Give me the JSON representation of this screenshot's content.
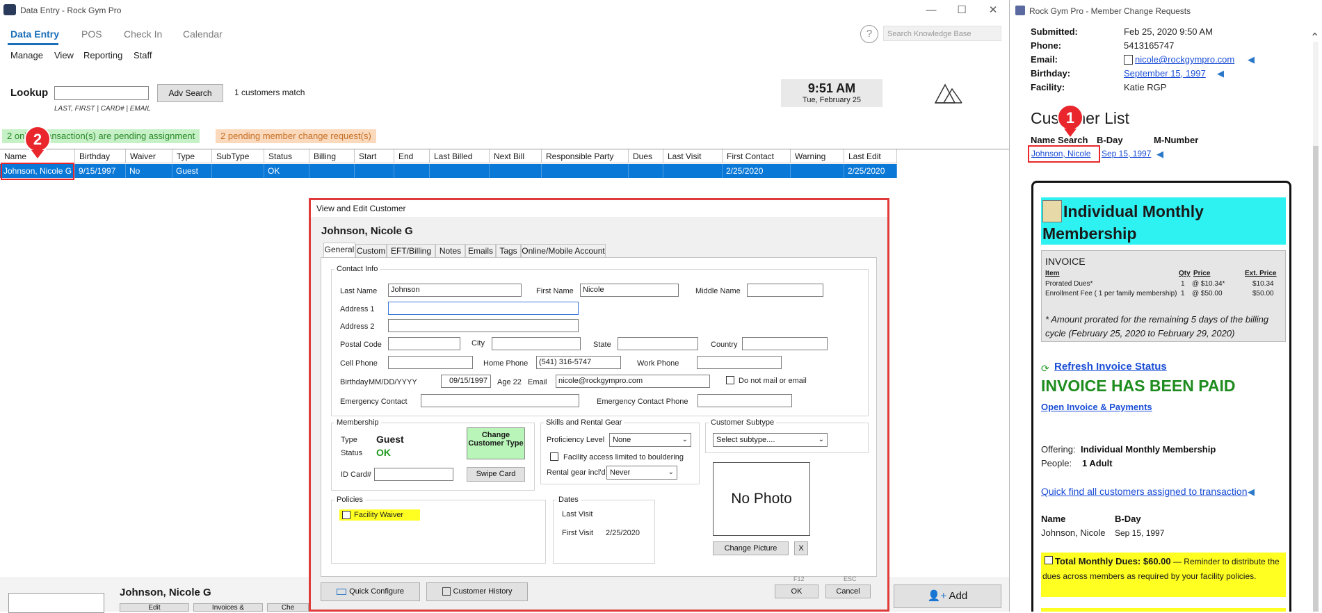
{
  "main": {
    "title": "Data Entry - Rock Gym Pro",
    "nav_tabs": [
      "Data Entry",
      "POS",
      "Check In",
      "Calendar"
    ],
    "menu": [
      "Manage",
      "View",
      "Reporting",
      "Staff"
    ],
    "kb_search_placeholder": "Search Knowledge Base",
    "help": "?",
    "lookup": {
      "label": "Lookup",
      "hint": "LAST, FIRST | CARD# | EMAIL",
      "adv_search": "Adv Search",
      "match_count": "1 customers match"
    },
    "clock": {
      "time": "9:51 AM",
      "date": "Tue, February 25"
    },
    "pending_transactions": "2 online transaction(s) are pending assignment",
    "pending_requests": "2 pending member change request(s)",
    "grid": {
      "columns": [
        "Name",
        "Birthday",
        "Waiver",
        "Type",
        "SubType",
        "Status",
        "Billing",
        "Start",
        "End",
        "Last Billed",
        "Next Bill",
        "Responsible Party",
        "Dues",
        "Last Visit",
        "First Contact",
        "Warning",
        "Last Edit"
      ],
      "row": [
        "Johnson, Nicole G",
        "9/15/1997",
        "No",
        "Guest",
        "",
        "OK",
        "",
        "",
        "",
        "",
        "",
        "",
        "",
        "",
        "2/25/2020",
        "",
        "2/25/2020"
      ]
    },
    "bottom": {
      "customer_name": "Johnson, Nicole G",
      "add_button": "Add",
      "btn1": "Edit",
      "btn2": "Invoices &",
      "btn3": "Che"
    }
  },
  "markers": {
    "one": "1",
    "two": "2"
  },
  "dialog": {
    "title": "View and Edit Customer",
    "customer_name": "Johnson, Nicole G",
    "tabs": [
      "General",
      "Custom",
      "EFT/Billing",
      "Notes",
      "Emails",
      "Tags",
      "Online/Mobile Account"
    ],
    "contact": {
      "group": "Contact Info",
      "last_name_label": "Last Name",
      "last_name": "Johnson",
      "first_name_label": "First Name",
      "first_name": "Nicole",
      "middle_name_label": "Middle Name",
      "address1_label": "Address 1",
      "address2_label": "Address 2",
      "postal_label": "Postal Code",
      "city_label": "City",
      "state_label": "State",
      "country_label": "Country",
      "cell_label": "Cell Phone",
      "home_label": "Home Phone",
      "home_phone": "(541) 316-5747",
      "work_label": "Work Phone",
      "birthday_label": "Birthday",
      "birthday_format": "MM/DD/YYYY",
      "birthday": "09/15/1997",
      "age": "Age 22",
      "email_label": "Email",
      "email": "nicole@rockgympro.com",
      "no_mail_label": "Do not mail or email",
      "emergency_label": "Emergency Contact",
      "emergency_phone_label": "Emergency Contact Phone"
    },
    "membership": {
      "group": "Membership",
      "type_label": "Type",
      "type": "Guest",
      "status_label": "Status",
      "status": "OK",
      "change_type": "Change Customer Type",
      "id_card_label": "ID Card#",
      "swipe_card": "Swipe Card"
    },
    "skills": {
      "group": "Skills and Rental Gear",
      "proficiency_label": "Proficiency Level",
      "proficiency": "None",
      "bouldering_label": "Facility access limited to bouldering",
      "rental_label": "Rental gear incl'd",
      "rental": "Never"
    },
    "subtype": {
      "group": "Customer Subtype",
      "value": "Select subtype...."
    },
    "photo": {
      "text": "No Photo",
      "change": "Change Picture",
      "remove": "X"
    },
    "policies": {
      "group": "Policies",
      "facility_waiver": "Facility Waiver"
    },
    "dates": {
      "group": "Dates",
      "last_visit_label": "Last Visit",
      "first_visit_label": "First Visit",
      "first_visit": "2/25/2020"
    },
    "footer": {
      "quick_configure": "Quick Configure",
      "customer_history": "Customer History",
      "ok": "OK",
      "ok_key": "F12",
      "cancel": "Cancel",
      "cancel_key": "ESC"
    }
  },
  "right": {
    "title": "Rock Gym Pro - Member Change Requests",
    "submitted_label": "Submitted:",
    "submitted": "Feb 25, 2020 9:50 AM",
    "phone_label": "Phone:",
    "phone": "5413165747",
    "email_label": "Email:",
    "email": "nicole@rockgympro.com",
    "birthday_label": "Birthday:",
    "birthday": "September 15, 1997",
    "facility_label": "Facility:",
    "facility": "Katie RGP",
    "customer_list_heading": "Customer List",
    "list_cols": [
      "Name Search",
      "B-Day",
      "M-Number"
    ],
    "list_row": {
      "name": "Johnson, Nicole",
      "bday": "Sep 15, 1997"
    },
    "card": {
      "title": "Individual Monthly Membership",
      "invoice_heading": "INVOICE",
      "invoice_cols": [
        "Item",
        "Qty",
        "Price",
        "Ext. Price"
      ],
      "invoice_rows": [
        [
          "Prorated Dues*",
          "1",
          "@ $10.34*",
          "$10.34"
        ],
        [
          "Enrollment Fee ( 1 per family membership)",
          "1",
          "@ $50.00",
          "$50.00"
        ]
      ],
      "prorate_note": "* Amount prorated for the remaining 5 days of the billing cycle (February 25, 2020 to February 29, 2020)",
      "refresh": "Refresh Invoice Status",
      "paid": "INVOICE HAS BEEN PAID",
      "open_invoice": "Open Invoice & Payments",
      "offering_label": "Offering:",
      "offering": "Individual Monthly Membership",
      "people_label": "People:",
      "people": "1 Adult",
      "quick_find": "Quick find all customers assigned to transaction",
      "name_col": "Name",
      "bday_col": "B-Day",
      "person_name": "Johnson, Nicole",
      "person_bday": "Sep 15, 1997",
      "dues_label": "Total Monthly Dues: $60.00",
      "dues_note": " — Reminder to distribute the dues across members as required by your facility policies."
    }
  },
  "colors": {
    "accent": "#1a6fb8",
    "selected_row": "#0a78d7",
    "highlight_red": "#e8262b",
    "paid_green": "#1e8c1e",
    "cyan": "#2ef2f2",
    "yellow": "#ffff22"
  }
}
